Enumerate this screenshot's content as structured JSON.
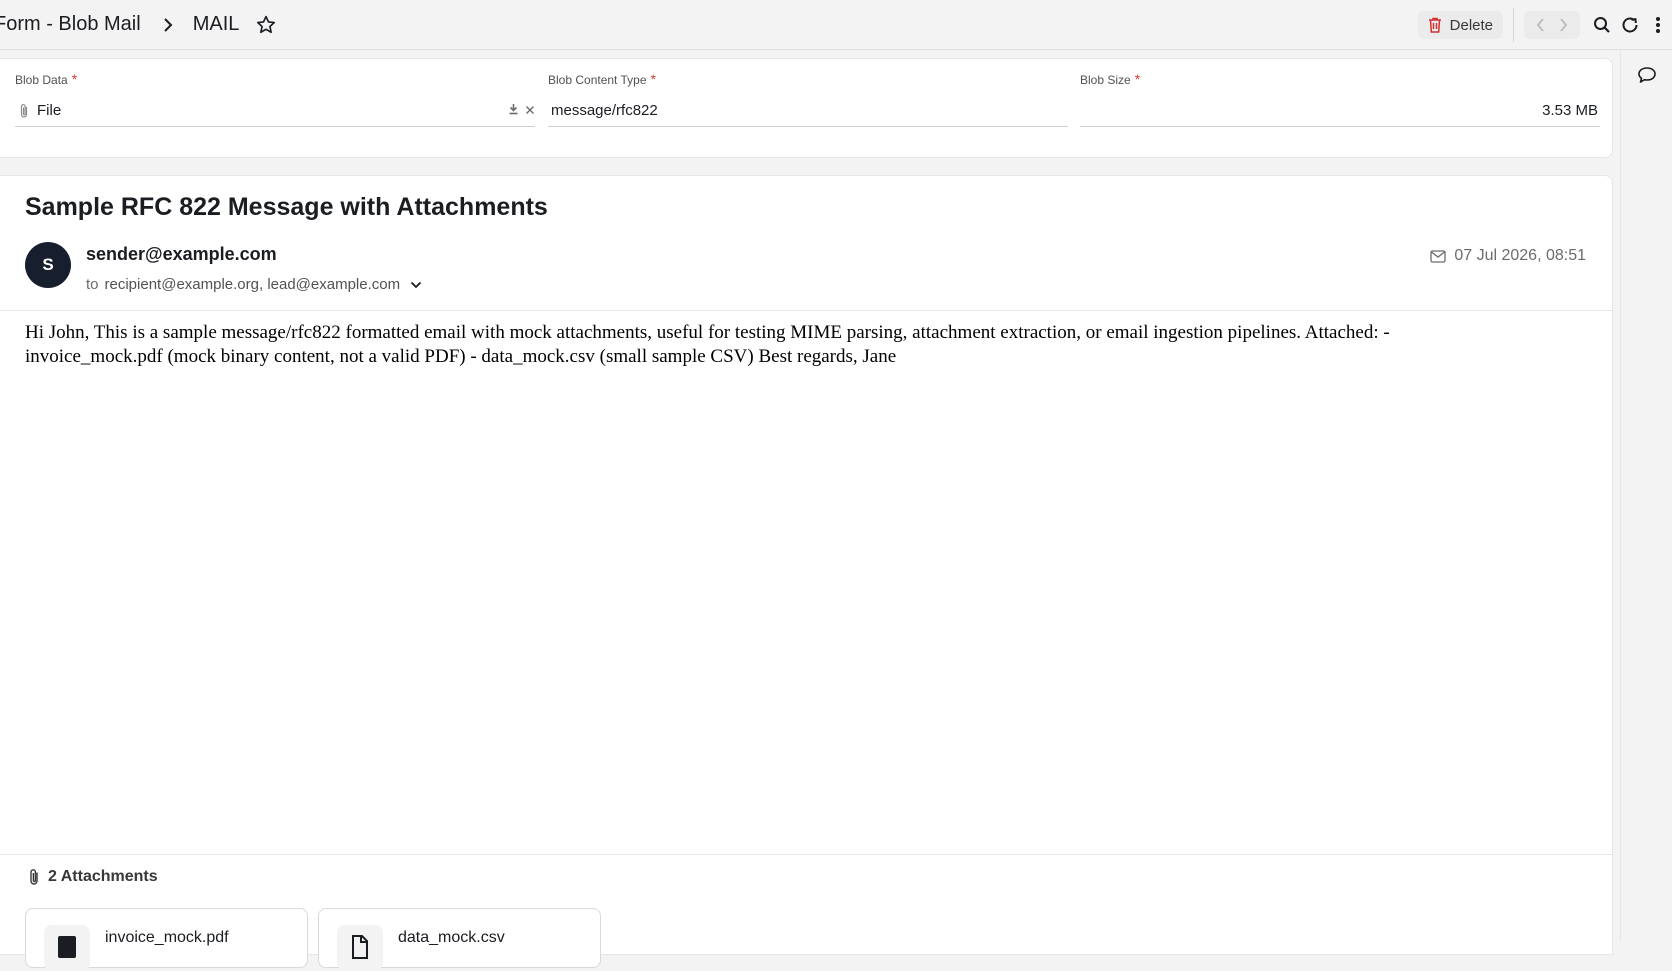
{
  "header": {
    "breadcrumb_parent": "Form - Blob Mail",
    "breadcrumb_current": "MAIL",
    "delete_label": "Delete"
  },
  "fields": {
    "blob_data": {
      "label": "Blob Data",
      "required": "*",
      "value": "File"
    },
    "blob_content_type": {
      "label": "Blob Content Type",
      "required": "*",
      "value": "message/rfc822"
    },
    "blob_size": {
      "label": "Blob Size",
      "required": "*",
      "value": "3.53 MB"
    }
  },
  "mail": {
    "subject": "Sample RFC 822 Message with Attachments",
    "avatar_initial": "S",
    "from": "sender@example.com",
    "to_prefix": "to",
    "to": "recipient@example.org, lead@example.com",
    "date": "07 Jul 2026, 08:51",
    "body": "Hi John, This is a sample message/rfc822 formatted email with mock attachments, useful for testing MIME parsing, attachment extraction, or email ingestion pipelines. Attached: - invoice_mock.pdf (mock binary content, not a valid PDF) - data_mock.csv (small sample CSV) Best regards, Jane",
    "attachments_heading": "2 Attachments",
    "attachments": [
      {
        "name": "invoice_mock.pdf",
        "icon": "pdf-file-icon"
      },
      {
        "name": "data_mock.csv",
        "icon": "document-file-icon"
      }
    ]
  },
  "colors": {
    "required": "#e03636",
    "avatar_bg": "#171f2e",
    "delete_icon": "#d32f2f"
  }
}
